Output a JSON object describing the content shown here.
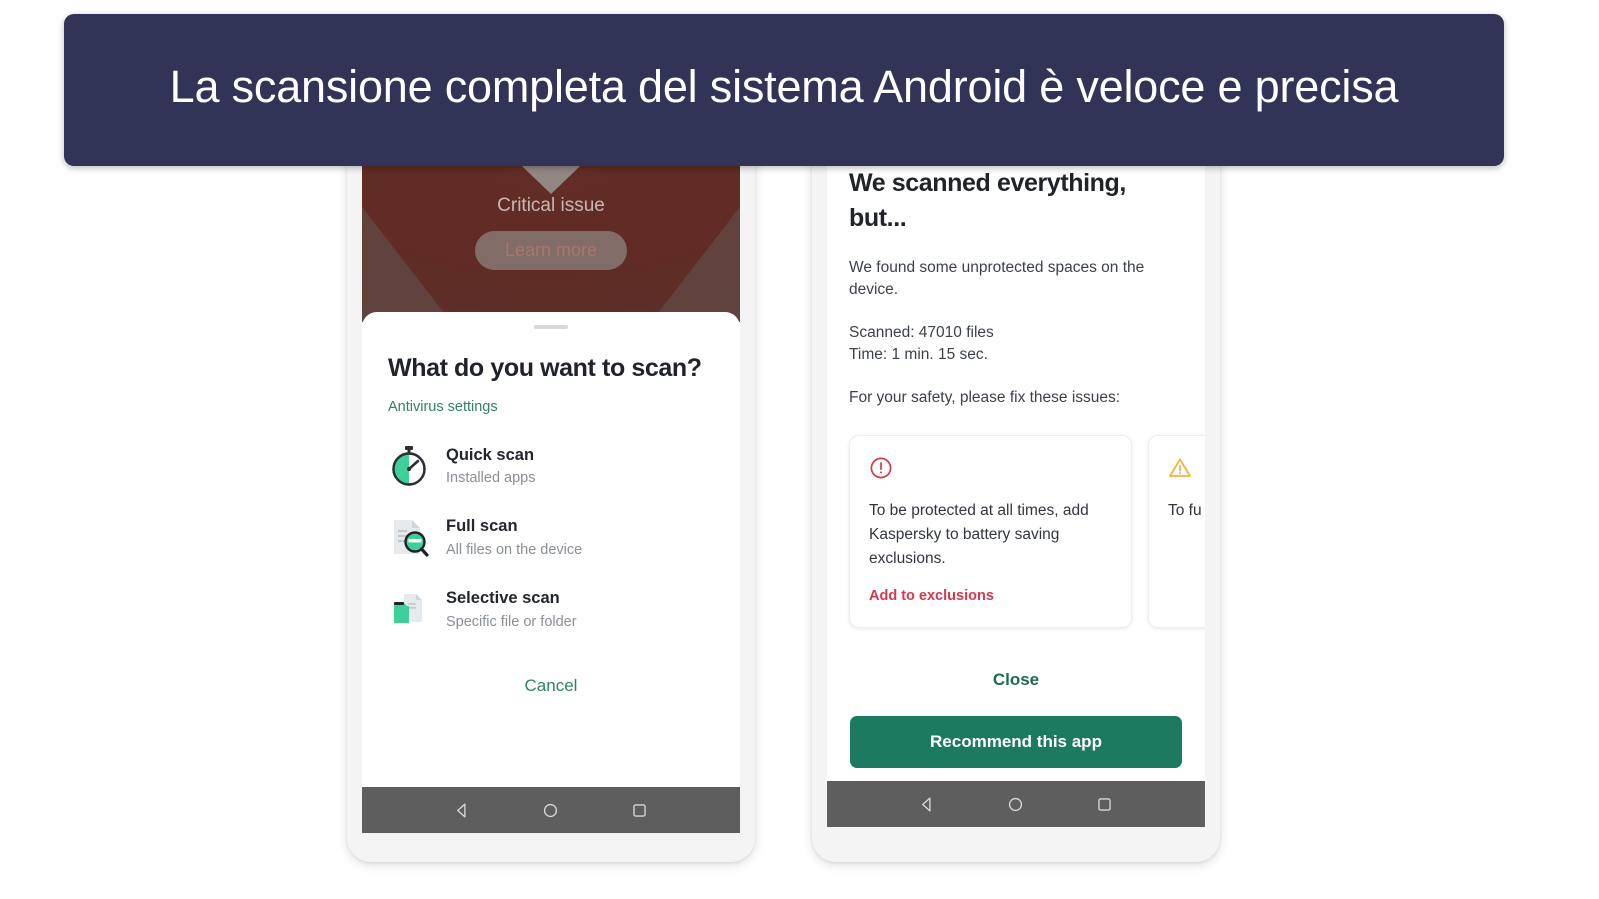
{
  "banner": {
    "text": "La scansione completa del sistema Android è veloce e precisa",
    "background_color": "#313357",
    "text_color": "#ffffff"
  },
  "left_phone": {
    "backdrop": {
      "status_label": "Critical issue",
      "learn_more_label": "Learn more",
      "shield_icon": "shield-chevron-icon",
      "background_color": "#7a2215"
    },
    "sheet": {
      "title": "What do you want to scan?",
      "settings_link": "Antivirus settings",
      "settings_link_color": "#2f8268",
      "options": [
        {
          "icon": "stopwatch-icon",
          "title": "Quick scan",
          "subtitle": "Installed apps"
        },
        {
          "icon": "document-magnifier-icon",
          "title": "Full scan",
          "subtitle": "All files on the device"
        },
        {
          "icon": "folder-file-icon",
          "title": "Selective scan",
          "subtitle": "Specific file or folder"
        }
      ],
      "cancel_label": "Cancel",
      "cancel_color": "#2f8268"
    },
    "navbar": {
      "back_icon": "triangle-back-icon",
      "home_icon": "circle-home-icon",
      "recents_icon": "square-recents-icon",
      "background_color": "#5e5e5e"
    }
  },
  "right_phone": {
    "title": "We scanned everything, but...",
    "paragraph_found": "We found some unprotected spaces on the device.",
    "scanned_files": "Scanned: 47010 files",
    "scan_time": "Time: 1 min. 15 sec.",
    "paragraph_fix": "For your safety, please fix these issues:",
    "cards": [
      {
        "icon": "error-circle-icon",
        "icon_color": "#d6384c",
        "text": "To be protected at all times, add Kaspersky to battery saving exclusions.",
        "action_label": "Add to exclusions",
        "action_color": "#d6384c"
      },
      {
        "icon": "warning-triangle-icon",
        "icon_color": "#f3b33c",
        "text": "To fu app n folde",
        "action_label": "",
        "action_color": "#d6384c"
      }
    ],
    "close_label": "Close",
    "close_color": "#1f6a53",
    "recommend_label": "Recommend this app",
    "recommend_color": "#1b7a60",
    "navbar": {
      "back_icon": "triangle-back-icon",
      "home_icon": "circle-home-icon",
      "recents_icon": "square-recents-icon",
      "background_color": "#5e5e5e"
    }
  }
}
